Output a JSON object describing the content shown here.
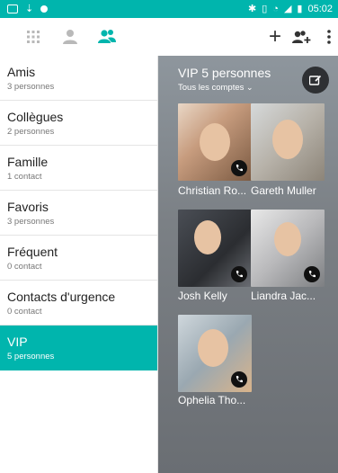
{
  "status_bar": {
    "time": "05:02"
  },
  "toolbar": {
    "tabs": [
      "dialpad-tab",
      "contacts-tab",
      "groups-tab"
    ],
    "accent": "#00b5ad"
  },
  "groups": [
    {
      "name": "Amis",
      "count": "3 personnes"
    },
    {
      "name": "Collègues",
      "count": "2 personnes"
    },
    {
      "name": "Famille",
      "count": "1 contact"
    },
    {
      "name": "Favoris",
      "count": "3 personnes"
    },
    {
      "name": "Fréquent",
      "count": "0 contact"
    },
    {
      "name": "Contacts d'urgence",
      "count": "0 contact"
    },
    {
      "name": "VIP",
      "count": "5 personnes"
    }
  ],
  "panel": {
    "title": "VIP 5 personnes",
    "account_filter": "Tous les comptes",
    "contacts": [
      {
        "name": "Christian Ro..."
      },
      {
        "name": "Gareth Muller"
      },
      {
        "name": "Josh Kelly"
      },
      {
        "name": "Liandra Jac..."
      },
      {
        "name": "Ophelia Tho..."
      }
    ]
  }
}
